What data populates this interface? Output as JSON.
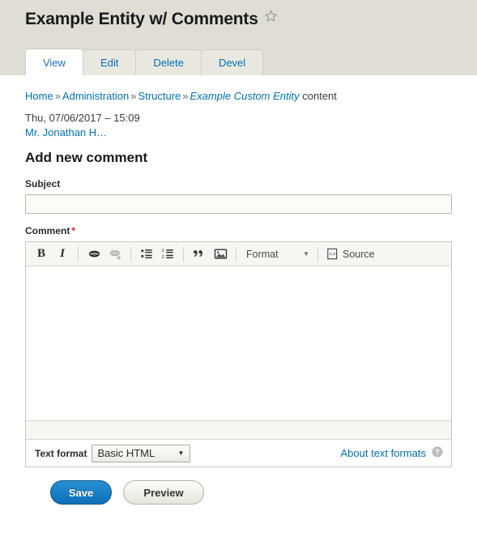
{
  "page": {
    "title": "Example Entity w/ Comments",
    "star_icon": "star-outline-icon"
  },
  "tabs": [
    {
      "label": "View",
      "active": true
    },
    {
      "label": "Edit",
      "active": false
    },
    {
      "label": "Delete",
      "active": false
    },
    {
      "label": "Devel",
      "active": false
    }
  ],
  "breadcrumb": {
    "items": [
      "Home",
      "Administration",
      "Structure"
    ],
    "separator": "»",
    "current_link": "Example Custom Entity",
    "current_suffix": "content"
  },
  "submitted": {
    "date": "Thu, 07/06/2017 – 15:09",
    "author": "Mr. Jonathan H…"
  },
  "form": {
    "heading": "Add new comment",
    "subject": {
      "label": "Subject",
      "value": "",
      "placeholder": ""
    },
    "comment": {
      "label": "Comment",
      "required_marker": "*",
      "value": ""
    }
  },
  "editor": {
    "toolbar": [
      {
        "name": "bold-icon",
        "glyph": "B",
        "label": "Bold",
        "disabled": false
      },
      {
        "name": "italic-icon",
        "glyph": "I",
        "label": "Italic",
        "disabled": false
      },
      {
        "name": "link-icon",
        "label": "Link",
        "disabled": false
      },
      {
        "name": "unlink-icon",
        "label": "Unlink",
        "disabled": true
      },
      {
        "name": "bulleted-list-icon",
        "label": "Bulleted list",
        "disabled": false
      },
      {
        "name": "numbered-list-icon",
        "label": "Numbered list",
        "disabled": false
      },
      {
        "name": "blockquote-icon",
        "label": "Block quote",
        "disabled": false
      },
      {
        "name": "image-icon",
        "label": "Image",
        "disabled": false
      }
    ],
    "format_label": "Format",
    "format_caret": "▼",
    "source_label": "Source"
  },
  "text_format": {
    "label": "Text format",
    "selected": "Basic HTML",
    "caret": "▼",
    "about_link": "About text formats",
    "help_icon": "help-circle-icon"
  },
  "actions": {
    "save_label": "Save",
    "preview_label": "Preview"
  },
  "colors": {
    "link": "#0071b3",
    "primary_button": "#0b70b8",
    "required": "#d3231f",
    "band": "#deded6"
  }
}
